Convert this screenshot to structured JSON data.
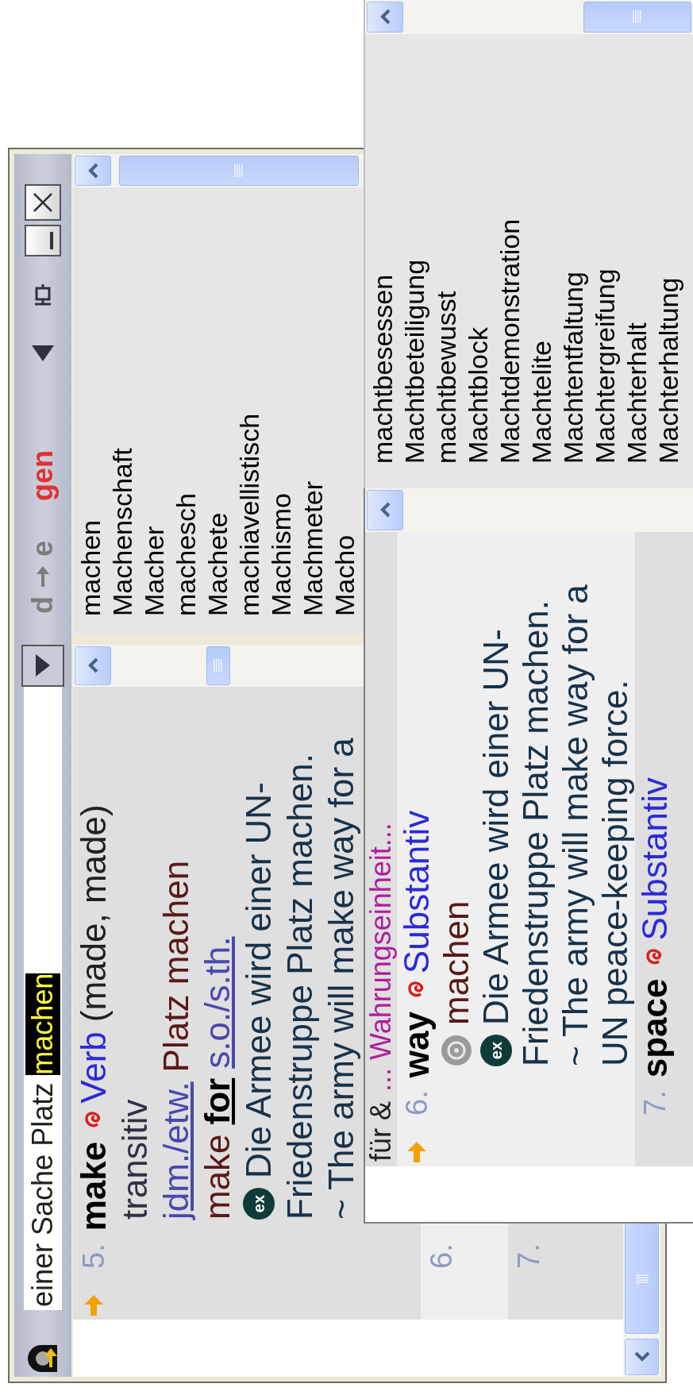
{
  "main_window": {
    "search": {
      "parts": [
        {
          "text": "einer Sache Platz",
          "selected": false
        },
        {
          "text": "machen",
          "selected": true
        }
      ]
    },
    "direction": {
      "from": "d",
      "to": "e"
    },
    "mode": "gen",
    "word_list": [
      "machen",
      "Machenschaft",
      "Macher",
      "machesch",
      "Machete",
      "machiavellistisch",
      "Machismo",
      "Machmeter",
      "Macho"
    ],
    "results": [
      {
        "number": "5.",
        "current": true,
        "headword": "make",
        "pos": "Verb",
        "forms": "(made, made)",
        "lines": [
          {
            "kind": "plain",
            "segments": [
              {
                "text": "transitiv",
                "kind": "label"
              }
            ]
          },
          {
            "kind": "plain",
            "segments": [
              {
                "text": "jdm./etw.",
                "kind": "link"
              },
              {
                "text": "Platz machen",
                "kind": "source"
              }
            ]
          },
          {
            "kind": "plain",
            "segments": [
              {
                "text": "make",
                "kind": "source"
              },
              {
                "text": "for",
                "kind": "strong"
              },
              {
                "text": "s.o./s.th.",
                "kind": "link"
              }
            ]
          },
          {
            "kind": "example",
            "badge": "ex",
            "segments": [
              {
                "text": "Die Armee wird einer UN-",
                "kind": "example"
              }
            ]
          },
          {
            "kind": "plain",
            "segments": [
              {
                "text": "Friedenstruppe Platz machen.",
                "kind": "example"
              }
            ]
          },
          {
            "kind": "plain",
            "segments": [
              {
                "text": "~ The army will make way for a",
                "kind": "example"
              }
            ]
          }
        ]
      },
      {
        "number": "6.",
        "current": false
      },
      {
        "number": "7.",
        "current": false
      }
    ]
  },
  "word_list_window": {
    "words": [
      "machtbesessen",
      "Machtbeteiligung",
      "machtbewusst",
      "Machtblock",
      "Machtdemonstration",
      "Machtelite",
      "Machtentfaltung",
      "Machtergreifung",
      "Machterhalt",
      "Machterhaltung"
    ]
  },
  "result_window": {
    "lead_line": [
      {
        "text": "für &",
        "kind": "plain"
      },
      {
        "text": "... Wahrungseinheit...",
        "kind": "reference"
      }
    ],
    "results": [
      {
        "number": "6.",
        "current": true,
        "headword": "way",
        "pos": "Substantiv",
        "lines": [
          {
            "kind": "meaning",
            "segments": [
              {
                "text": "machen",
                "kind": "source"
              }
            ]
          },
          {
            "kind": "example",
            "badge": "ex",
            "segments": [
              {
                "text": "Die Armee wird einer UN-",
                "kind": "example"
              }
            ]
          },
          {
            "kind": "plain",
            "segments": [
              {
                "text": "Friedenstruppe Platz machen.",
                "kind": "example"
              }
            ]
          },
          {
            "kind": "plain",
            "segments": [
              {
                "text": "~ The army will make way for a",
                "kind": "example"
              }
            ]
          },
          {
            "kind": "plain",
            "segments": [
              {
                "text": "UN peace-keeping force.",
                "kind": "example"
              }
            ]
          }
        ]
      },
      {
        "number": "7.",
        "current": false,
        "headword": "space",
        "pos": "Substantiv"
      }
    ]
  }
}
